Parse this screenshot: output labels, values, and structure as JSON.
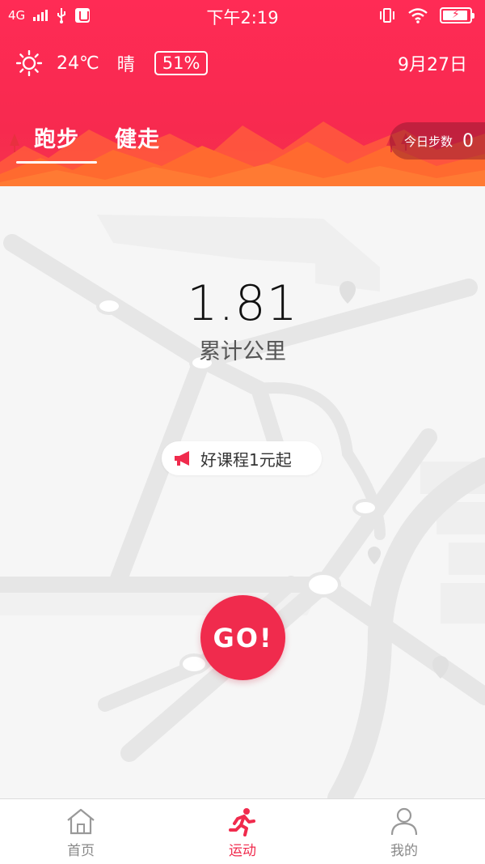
{
  "status_bar": {
    "network": "4G",
    "time": "下午2:19"
  },
  "weather": {
    "temperature": "24℃",
    "condition": "晴",
    "aqi": "51%",
    "date": "9月27日",
    "icon": "sun-icon"
  },
  "tabs": [
    {
      "label": "跑步",
      "active": true
    },
    {
      "label": "健走",
      "active": false
    }
  ],
  "today_steps": {
    "label": "今日步数",
    "value": "0"
  },
  "summary": {
    "distance": "1.81",
    "distance_label": "累计公里"
  },
  "promo": {
    "text": "好课程1元起",
    "icon": "megaphone-icon"
  },
  "go_button": {
    "label": "GO!"
  },
  "bottom_nav": [
    {
      "label": "首页",
      "icon": "home-icon",
      "active": false
    },
    {
      "label": "运动",
      "icon": "runner-icon",
      "active": true
    },
    {
      "label": "我的",
      "icon": "user-icon",
      "active": false
    }
  ],
  "colors": {
    "accent": "#f02b4d",
    "header": "#ff2b55"
  }
}
